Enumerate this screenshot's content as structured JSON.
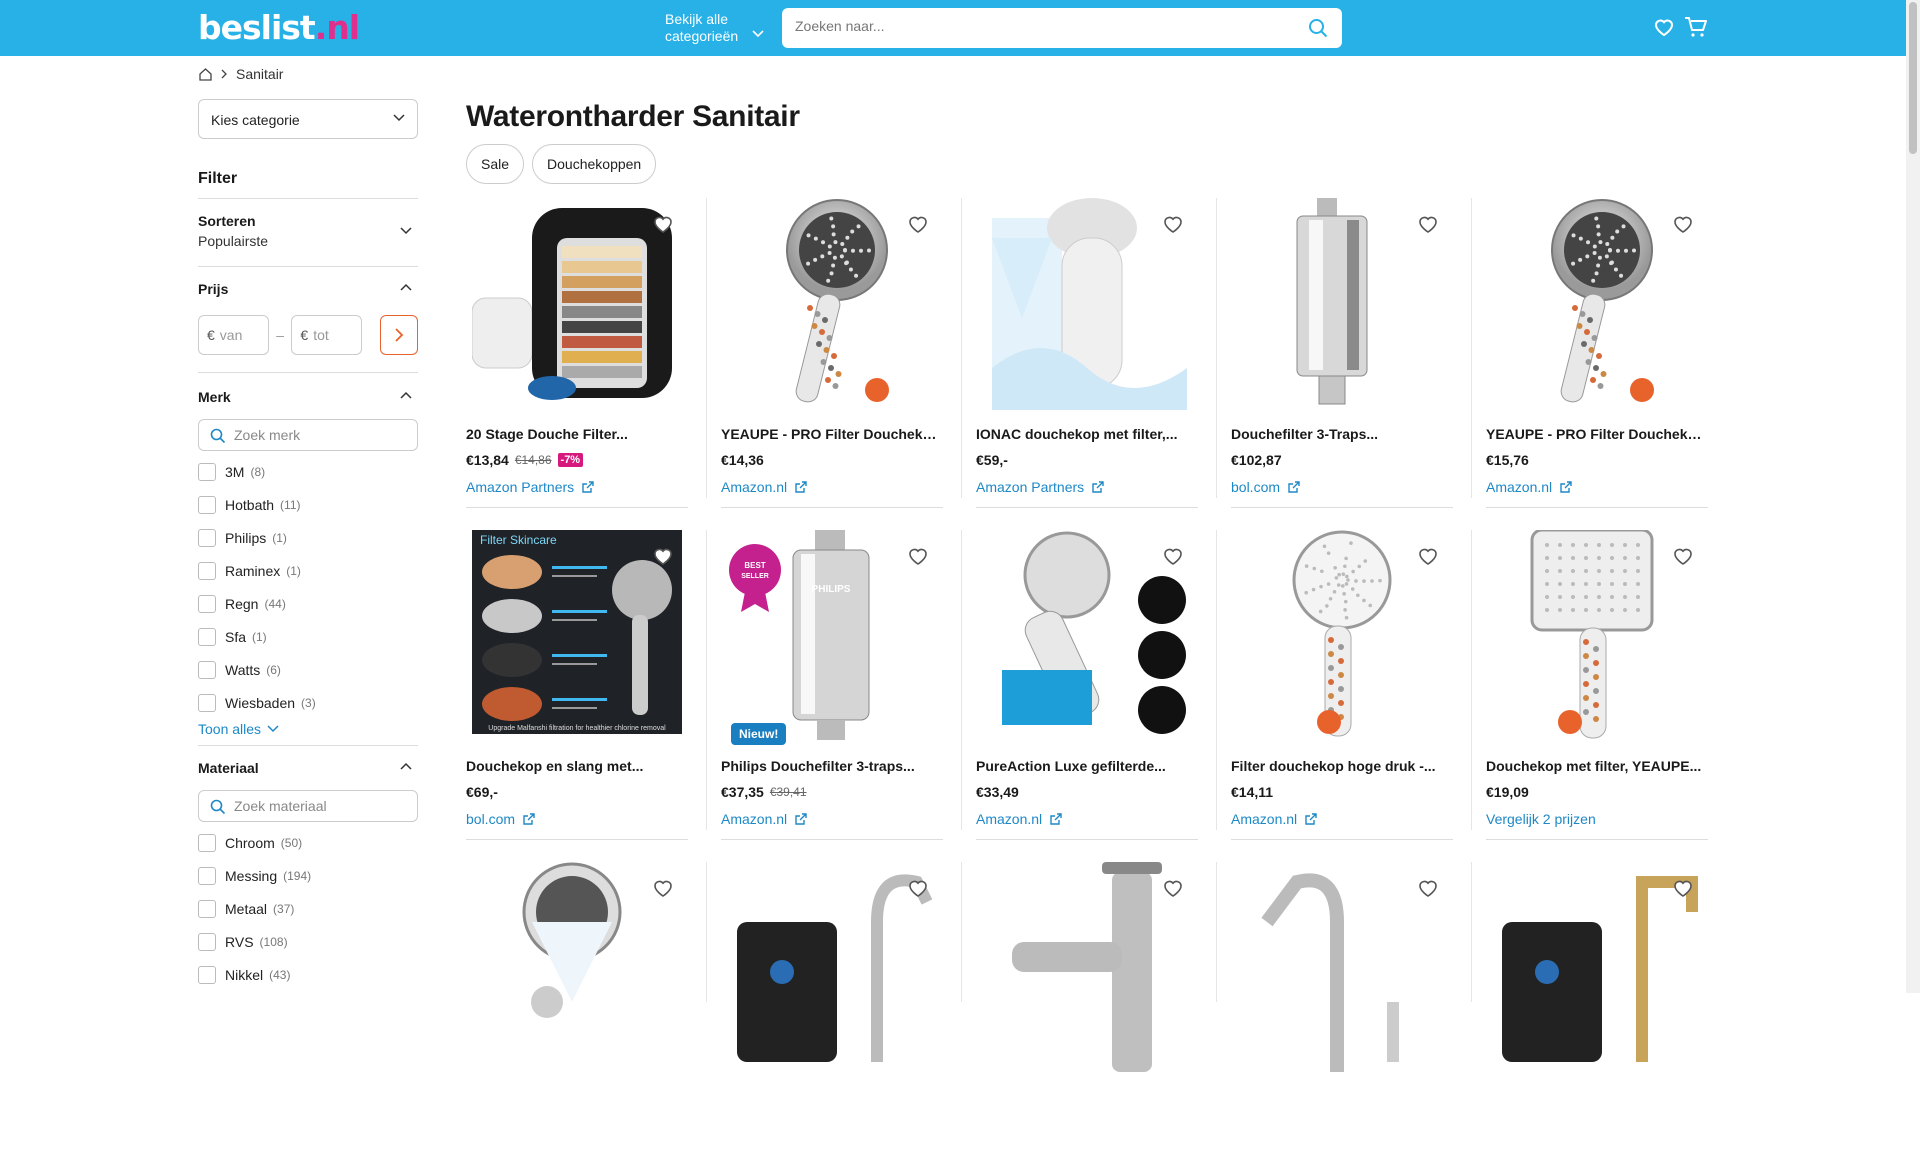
{
  "header": {
    "logo_main": "beslist",
    "logo_dot": ".",
    "logo_tld": "nl",
    "categories_line1": "Bekijk alle",
    "categories_line2": "categorieën",
    "search_placeholder": "Zoeken naar..."
  },
  "breadcrumb": {
    "current": "Sanitair"
  },
  "sidebar": {
    "category_select": "Kies categorie",
    "filter_title": "Filter",
    "sort_label": "Sorteren",
    "sort_value": "Populairste",
    "price_label": "Prijs",
    "price_from_currency": "€",
    "price_from_placeholder": "van",
    "price_to_currency": "€",
    "price_to_placeholder": "tot",
    "price_dash": "–",
    "brand_label": "Merk",
    "brand_search": "Zoek merk",
    "brands": [
      {
        "name": "3M",
        "count": "(8)"
      },
      {
        "name": "Hotbath",
        "count": "(11)"
      },
      {
        "name": "Philips",
        "count": "(1)"
      },
      {
        "name": "Raminex",
        "count": "(1)"
      },
      {
        "name": "Regn",
        "count": "(44)"
      },
      {
        "name": "Sfa",
        "count": "(1)"
      },
      {
        "name": "Watts",
        "count": "(6)"
      },
      {
        "name": "Wiesbaden",
        "count": "(3)"
      }
    ],
    "show_all": "Toon alles",
    "material_label": "Materiaal",
    "material_search": "Zoek materiaal",
    "materials": [
      {
        "name": "Chroom",
        "count": "(50)"
      },
      {
        "name": "Messing",
        "count": "(194)"
      },
      {
        "name": "Metaal",
        "count": "(37)"
      },
      {
        "name": "RVS",
        "count": "(108)"
      },
      {
        "name": "Nikkel",
        "count": "(43)"
      }
    ]
  },
  "main": {
    "title": "Waterontharder Sanitair",
    "chips": [
      "Sale",
      "Douchekoppen"
    ],
    "products": [
      {
        "name": "20 Stage Douche Filter...",
        "price": "€13,84",
        "old": "€14,86",
        "disc": "-7%",
        "shop": "Amazon Partners"
      },
      {
        "name": "YEAUPE - PRO Filter Douchekop -...",
        "price": "€14,36",
        "shop": "Amazon.nl"
      },
      {
        "name": "IONAC douchekop met filter,...",
        "price": "€59,-",
        "shop": "Amazon Partners"
      },
      {
        "name": "Douchefilter 3-Traps...",
        "price": "€102,87",
        "shop": "bol.com"
      },
      {
        "name": "YEAUPE - PRO Filter Douchekop -...",
        "price": "€15,76",
        "shop": "Amazon.nl"
      },
      {
        "name": "Douchekop en slang met...",
        "price": "€69,-",
        "shop": "bol.com",
        "img_text": "Filter Skincare",
        "img_footer": "Upgrade Malfanshi filtration for healthier chlorine removal"
      },
      {
        "name": "Philips Douchefilter 3-traps...",
        "price": "€37,35",
        "old": "€39,41",
        "shop": "Amazon.nl",
        "badge": "Nieuw!",
        "img_text": "PHILIPS",
        "seal": "BEST SELLER"
      },
      {
        "name": "PureAction Luxe gefilterde...",
        "price": "€33,49",
        "shop": "Amazon.nl"
      },
      {
        "name": "Filter douchekop hoge druk -...",
        "price": "€14,11",
        "shop": "Amazon.nl"
      },
      {
        "name": "Douchekop met filter, YEAUPE...",
        "price": "€19,09",
        "shop": "Vergelijk 2 prijzen"
      }
    ]
  },
  "colors": {
    "brand": "#27b1e6",
    "accent": "#e8622c",
    "link": "#1e88c7",
    "discount": "#d6197c"
  }
}
